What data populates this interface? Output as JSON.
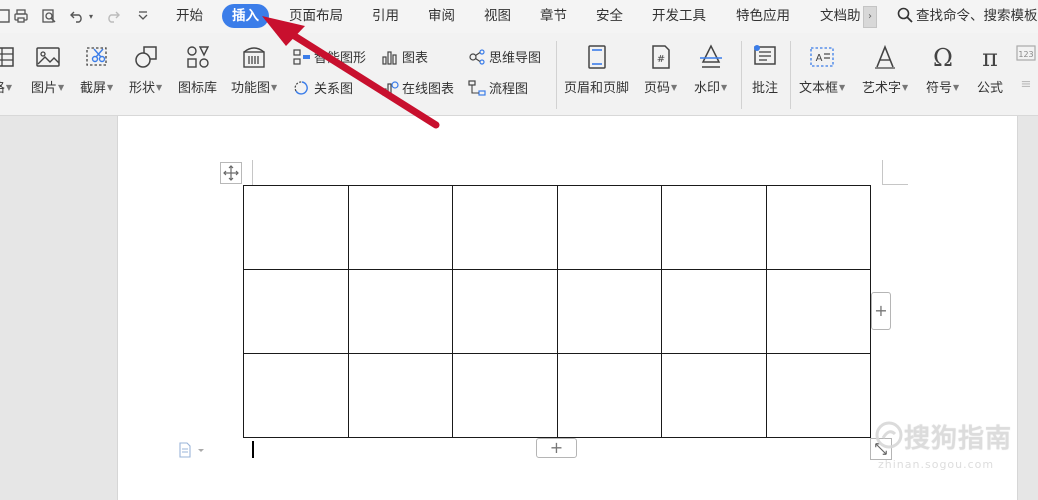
{
  "menubar": {
    "tabs": [
      {
        "label": "开始",
        "active": false
      },
      {
        "label": "插入",
        "active": true
      },
      {
        "label": "页面布局",
        "active": false
      },
      {
        "label": "引用",
        "active": false
      },
      {
        "label": "审阅",
        "active": false
      },
      {
        "label": "视图",
        "active": false
      },
      {
        "label": "章节",
        "active": false
      },
      {
        "label": "安全",
        "active": false
      },
      {
        "label": "开发工具",
        "active": false
      },
      {
        "label": "特色应用",
        "active": false
      },
      {
        "label": "文档助",
        "active": false
      }
    ],
    "more": "›",
    "search": "查找命令、搜索模板"
  },
  "ribbon": {
    "table_partial": "格",
    "picture": "图片",
    "screenshot": "截屏",
    "shapes": "形状",
    "icon_library": "图标库",
    "function_chart": "功能图",
    "smart_art": "智能图形",
    "chart": "图表",
    "mind_map": "思维导图",
    "relation_chart": "关系图",
    "online_chart": "在线图表",
    "flowchart": "流程图",
    "header_footer": "页眉和页脚",
    "page_number": "页码",
    "watermark": "水印",
    "comment": "批注",
    "text_box": "文本框",
    "word_art": "艺术字",
    "symbol": "符号",
    "formula": "公式",
    "caret": "▼"
  },
  "document": {
    "table": {
      "rows": 3,
      "cols": 6
    },
    "add_label": "+"
  },
  "watermark_text": {
    "main": "搜狗指南",
    "sub": "zhinan.sogou.com"
  },
  "colors": {
    "accent": "#3b7de9",
    "annotation_arrow": "#c8102e"
  }
}
